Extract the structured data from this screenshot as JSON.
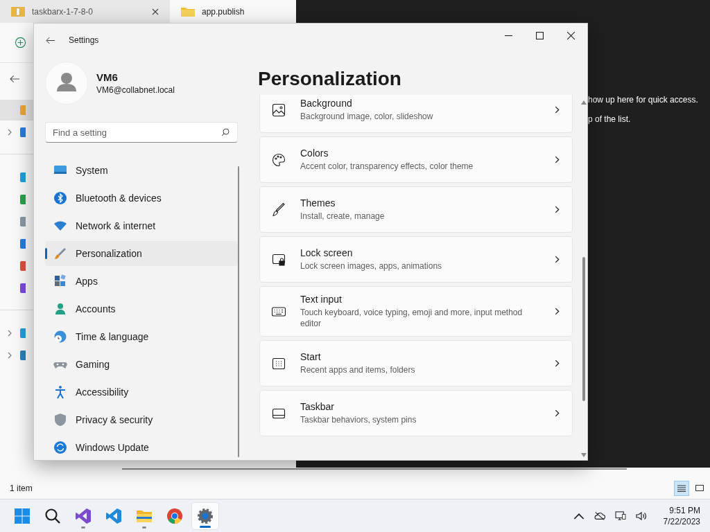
{
  "explorer": {
    "tabs": [
      {
        "label": "taskbarx-1-7-8-0",
        "kind": "zip",
        "selected": false
      },
      {
        "label": "app.publish",
        "kind": "folder",
        "selected": true
      }
    ],
    "nav": [
      {
        "kind": "home",
        "selected": true,
        "expandable": false,
        "group_start": false
      },
      {
        "kind": "cloud",
        "selected": false,
        "expandable": true,
        "group_start": false
      },
      {
        "kind": "desktop",
        "selected": false,
        "expandable": false,
        "group_start": true
      },
      {
        "kind": "download",
        "selected": false,
        "expandable": false,
        "group_start": false
      },
      {
        "kind": "documents",
        "selected": false,
        "expandable": false,
        "group_start": false
      },
      {
        "kind": "pictures",
        "selected": false,
        "expandable": false,
        "group_start": false
      },
      {
        "kind": "music",
        "selected": false,
        "expandable": false,
        "group_start": false
      },
      {
        "kind": "videos",
        "selected": false,
        "expandable": false,
        "group_start": false
      },
      {
        "kind": "pc",
        "selected": false,
        "expandable": true,
        "group_start": true
      },
      {
        "kind": "network",
        "selected": false,
        "expandable": true,
        "group_start": false
      }
    ],
    "hint_lines": [
      "how up here for quick access.",
      "p of the list."
    ],
    "status": "1 item",
    "views": [
      {
        "kind": "details",
        "selected": true
      },
      {
        "kind": "tiles",
        "selected": false
      }
    ]
  },
  "settings": {
    "title": "Settings",
    "user": {
      "name": "VM6",
      "email": "VM6@collabnet.local"
    },
    "search": {
      "placeholder": "Find a setting"
    },
    "nav": [
      {
        "label": "System",
        "kind": "system",
        "selected": false
      },
      {
        "label": "Bluetooth & devices",
        "kind": "bluetooth",
        "selected": false
      },
      {
        "label": "Network & internet",
        "kind": "network",
        "selected": false
      },
      {
        "label": "Personalization",
        "kind": "brush",
        "selected": true
      },
      {
        "label": "Apps",
        "kind": "apps",
        "selected": false
      },
      {
        "label": "Accounts",
        "kind": "accounts",
        "selected": false
      },
      {
        "label": "Time & language",
        "kind": "time",
        "selected": false
      },
      {
        "label": "Gaming",
        "kind": "gaming",
        "selected": false
      },
      {
        "label": "Accessibility",
        "kind": "accessibility",
        "selected": false
      },
      {
        "label": "Privacy & security",
        "kind": "privacy",
        "selected": false
      },
      {
        "label": "Windows Update",
        "kind": "update",
        "selected": false
      }
    ],
    "page_title": "Personalization",
    "items": [
      {
        "title": "Background",
        "subtitle": "Background image, color, slideshow",
        "kind": "image"
      },
      {
        "title": "Colors",
        "subtitle": "Accent color, transparency effects, color theme",
        "kind": "palette"
      },
      {
        "title": "Themes",
        "subtitle": "Install, create, manage",
        "kind": "brush"
      },
      {
        "title": "Lock screen",
        "subtitle": "Lock screen images, apps, animations",
        "kind": "lock"
      },
      {
        "title": "Text input",
        "subtitle": "Touch keyboard, voice typing, emoji and more, input method editor",
        "kind": "keyboard"
      },
      {
        "title": "Start",
        "subtitle": "Recent apps and items, folders",
        "kind": "start"
      },
      {
        "title": "Taskbar",
        "subtitle": "Taskbar behaviors, system pins",
        "kind": "taskbar"
      }
    ]
  },
  "taskbar": {
    "apps": [
      {
        "kind": "start",
        "running": false,
        "selected": false
      },
      {
        "kind": "search",
        "running": false,
        "selected": false
      },
      {
        "kind": "studio",
        "running": true,
        "selected": false
      },
      {
        "kind": "code",
        "running": false,
        "selected": false
      },
      {
        "kind": "files",
        "running": true,
        "selected": false
      },
      {
        "kind": "browser",
        "running": false,
        "selected": false
      },
      {
        "kind": "settings",
        "running": true,
        "selected": true
      }
    ],
    "time": "9:51 PM",
    "date": "7/22/2023"
  }
}
